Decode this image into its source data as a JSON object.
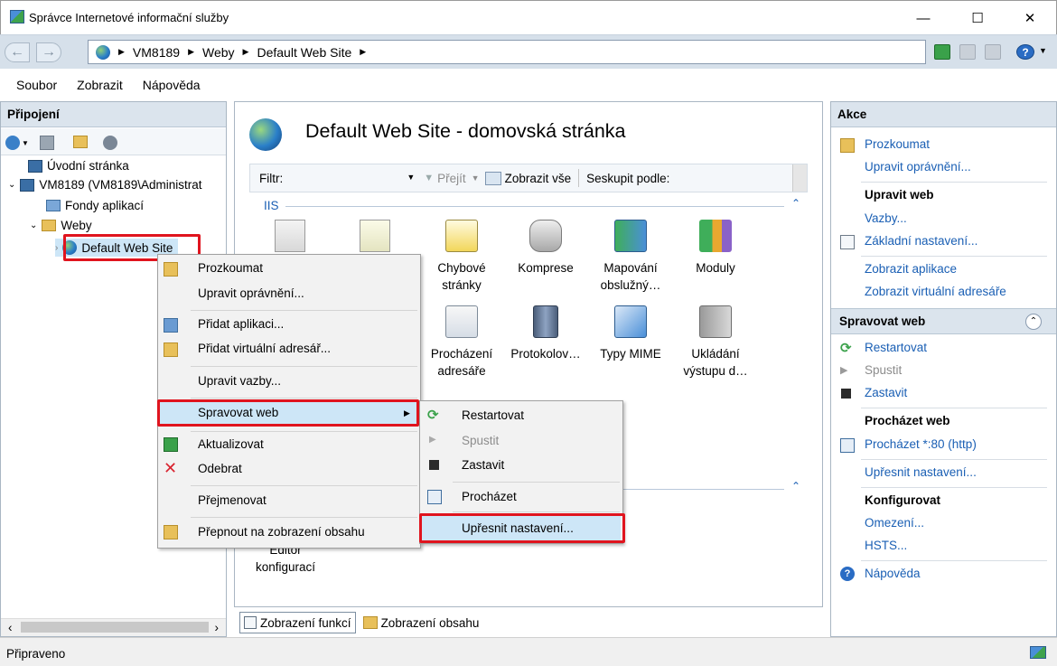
{
  "window": {
    "title": "Správce Internetové informační služby",
    "minimize": "—",
    "maximize": "☐",
    "close": "✕"
  },
  "breadcrumb": [
    "VM8189",
    "Weby",
    "Default Web Site"
  ],
  "menubar": [
    "Soubor",
    "Zobrazit",
    "Nápověda"
  ],
  "left": {
    "header": "Připojení",
    "tree": [
      "Úvodní stránka",
      "VM8189 (VM8189\\Administrat",
      "Fondy aplikací",
      "Weby",
      "Default Web Site"
    ]
  },
  "center": {
    "title": "Default Web Site - domovská stránka",
    "filter_label": "Filtr:",
    "go": "Přejít",
    "show_all": "Zobrazit vše",
    "group_by": "Seskupit podle:",
    "group_iis": "IIS",
    "features": [
      {
        "label": "Chybové stránky",
        "icon": "error-pages-icon"
      },
      {
        "label": "Komprese",
        "icon": "compression-icon"
      },
      {
        "label": "Mapování obslužný…",
        "icon": "handler-mappings-icon"
      },
      {
        "label": "Moduly",
        "icon": "modules-icon"
      },
      {
        "label": "Procházení adresáře",
        "icon": "directory-browsing-icon"
      },
      {
        "label": "Protokolov…",
        "icon": "logging-icon"
      },
      {
        "label": "Typy MIME",
        "icon": "mime-types-icon"
      },
      {
        "label": "Ukládání výstupu d…",
        "icon": "output-caching-icon"
      }
    ],
    "editor_label": "Editor konfigurací",
    "tab_features": "Zobrazení funkcí",
    "tab_content": "Zobrazení obsahu"
  },
  "right": {
    "header": "Akce",
    "explore": "Prozkoumat",
    "edit_permissions": "Upravit oprávnění...",
    "edit_site_title": "Upravit web",
    "bindings": "Vazby...",
    "basic_settings": "Základní nastavení...",
    "view_apps": "Zobrazit aplikace",
    "view_vdirs": "Zobrazit virtuální adresáře",
    "manage_title": "Spravovat web",
    "restart": "Restartovat",
    "start": "Spustit",
    "stop": "Zastavit",
    "browse_title": "Procházet web",
    "browse_link": "Procházet *:80 (http)",
    "advanced": "Upřesnit nastavení...",
    "configure_title": "Konfigurovat",
    "limits": "Omezení...",
    "hsts": "HSTS...",
    "help": "Nápověda"
  },
  "status": "Připraveno",
  "context_menu": [
    "Prozkoumat",
    "Upravit oprávnění...",
    "Přidat aplikaci...",
    "Přidat virtuální adresář...",
    "Upravit vazby...",
    "Spravovat web",
    "Aktualizovat",
    "Odebrat",
    "Přejmenovat",
    "Přepnout na zobrazení obsahu"
  ],
  "submenu": [
    "Restartovat",
    "Spustit",
    "Zastavit",
    "Procházet",
    "Upřesnit nastavení..."
  ],
  "colors": {
    "highlight_red": "#e0141e",
    "link_blue": "#1a5fb4"
  }
}
